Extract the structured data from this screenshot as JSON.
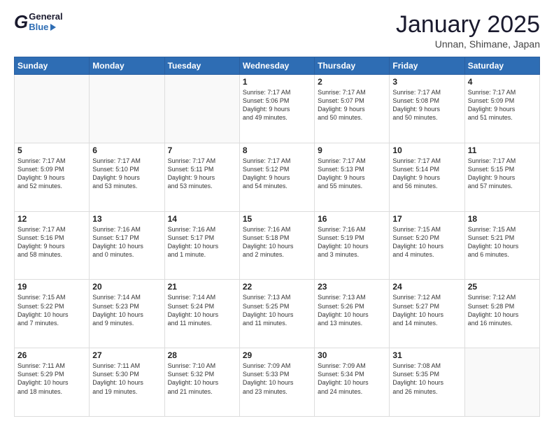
{
  "header": {
    "logo_general": "General",
    "logo_blue": "Blue",
    "title": "January 2025",
    "location": "Unnan, Shimane, Japan"
  },
  "days_of_week": [
    "Sunday",
    "Monday",
    "Tuesday",
    "Wednesday",
    "Thursday",
    "Friday",
    "Saturday"
  ],
  "weeks": [
    [
      {
        "num": "",
        "info": ""
      },
      {
        "num": "",
        "info": ""
      },
      {
        "num": "",
        "info": ""
      },
      {
        "num": "1",
        "info": "Sunrise: 7:17 AM\nSunset: 5:06 PM\nDaylight: 9 hours\nand 49 minutes."
      },
      {
        "num": "2",
        "info": "Sunrise: 7:17 AM\nSunset: 5:07 PM\nDaylight: 9 hours\nand 50 minutes."
      },
      {
        "num": "3",
        "info": "Sunrise: 7:17 AM\nSunset: 5:08 PM\nDaylight: 9 hours\nand 50 minutes."
      },
      {
        "num": "4",
        "info": "Sunrise: 7:17 AM\nSunset: 5:09 PM\nDaylight: 9 hours\nand 51 minutes."
      }
    ],
    [
      {
        "num": "5",
        "info": "Sunrise: 7:17 AM\nSunset: 5:09 PM\nDaylight: 9 hours\nand 52 minutes."
      },
      {
        "num": "6",
        "info": "Sunrise: 7:17 AM\nSunset: 5:10 PM\nDaylight: 9 hours\nand 53 minutes."
      },
      {
        "num": "7",
        "info": "Sunrise: 7:17 AM\nSunset: 5:11 PM\nDaylight: 9 hours\nand 53 minutes."
      },
      {
        "num": "8",
        "info": "Sunrise: 7:17 AM\nSunset: 5:12 PM\nDaylight: 9 hours\nand 54 minutes."
      },
      {
        "num": "9",
        "info": "Sunrise: 7:17 AM\nSunset: 5:13 PM\nDaylight: 9 hours\nand 55 minutes."
      },
      {
        "num": "10",
        "info": "Sunrise: 7:17 AM\nSunset: 5:14 PM\nDaylight: 9 hours\nand 56 minutes."
      },
      {
        "num": "11",
        "info": "Sunrise: 7:17 AM\nSunset: 5:15 PM\nDaylight: 9 hours\nand 57 minutes."
      }
    ],
    [
      {
        "num": "12",
        "info": "Sunrise: 7:17 AM\nSunset: 5:16 PM\nDaylight: 9 hours\nand 58 minutes."
      },
      {
        "num": "13",
        "info": "Sunrise: 7:16 AM\nSunset: 5:17 PM\nDaylight: 10 hours\nand 0 minutes."
      },
      {
        "num": "14",
        "info": "Sunrise: 7:16 AM\nSunset: 5:17 PM\nDaylight: 10 hours\nand 1 minute."
      },
      {
        "num": "15",
        "info": "Sunrise: 7:16 AM\nSunset: 5:18 PM\nDaylight: 10 hours\nand 2 minutes."
      },
      {
        "num": "16",
        "info": "Sunrise: 7:16 AM\nSunset: 5:19 PM\nDaylight: 10 hours\nand 3 minutes."
      },
      {
        "num": "17",
        "info": "Sunrise: 7:15 AM\nSunset: 5:20 PM\nDaylight: 10 hours\nand 4 minutes."
      },
      {
        "num": "18",
        "info": "Sunrise: 7:15 AM\nSunset: 5:21 PM\nDaylight: 10 hours\nand 6 minutes."
      }
    ],
    [
      {
        "num": "19",
        "info": "Sunrise: 7:15 AM\nSunset: 5:22 PM\nDaylight: 10 hours\nand 7 minutes."
      },
      {
        "num": "20",
        "info": "Sunrise: 7:14 AM\nSunset: 5:23 PM\nDaylight: 10 hours\nand 9 minutes."
      },
      {
        "num": "21",
        "info": "Sunrise: 7:14 AM\nSunset: 5:24 PM\nDaylight: 10 hours\nand 11 minutes."
      },
      {
        "num": "22",
        "info": "Sunrise: 7:13 AM\nSunset: 5:25 PM\nDaylight: 10 hours\nand 11 minutes."
      },
      {
        "num": "23",
        "info": "Sunrise: 7:13 AM\nSunset: 5:26 PM\nDaylight: 10 hours\nand 13 minutes."
      },
      {
        "num": "24",
        "info": "Sunrise: 7:12 AM\nSunset: 5:27 PM\nDaylight: 10 hours\nand 14 minutes."
      },
      {
        "num": "25",
        "info": "Sunrise: 7:12 AM\nSunset: 5:28 PM\nDaylight: 10 hours\nand 16 minutes."
      }
    ],
    [
      {
        "num": "26",
        "info": "Sunrise: 7:11 AM\nSunset: 5:29 PM\nDaylight: 10 hours\nand 18 minutes."
      },
      {
        "num": "27",
        "info": "Sunrise: 7:11 AM\nSunset: 5:30 PM\nDaylight: 10 hours\nand 19 minutes."
      },
      {
        "num": "28",
        "info": "Sunrise: 7:10 AM\nSunset: 5:32 PM\nDaylight: 10 hours\nand 21 minutes."
      },
      {
        "num": "29",
        "info": "Sunrise: 7:09 AM\nSunset: 5:33 PM\nDaylight: 10 hours\nand 23 minutes."
      },
      {
        "num": "30",
        "info": "Sunrise: 7:09 AM\nSunset: 5:34 PM\nDaylight: 10 hours\nand 24 minutes."
      },
      {
        "num": "31",
        "info": "Sunrise: 7:08 AM\nSunset: 5:35 PM\nDaylight: 10 hours\nand 26 minutes."
      },
      {
        "num": "",
        "info": ""
      }
    ]
  ]
}
